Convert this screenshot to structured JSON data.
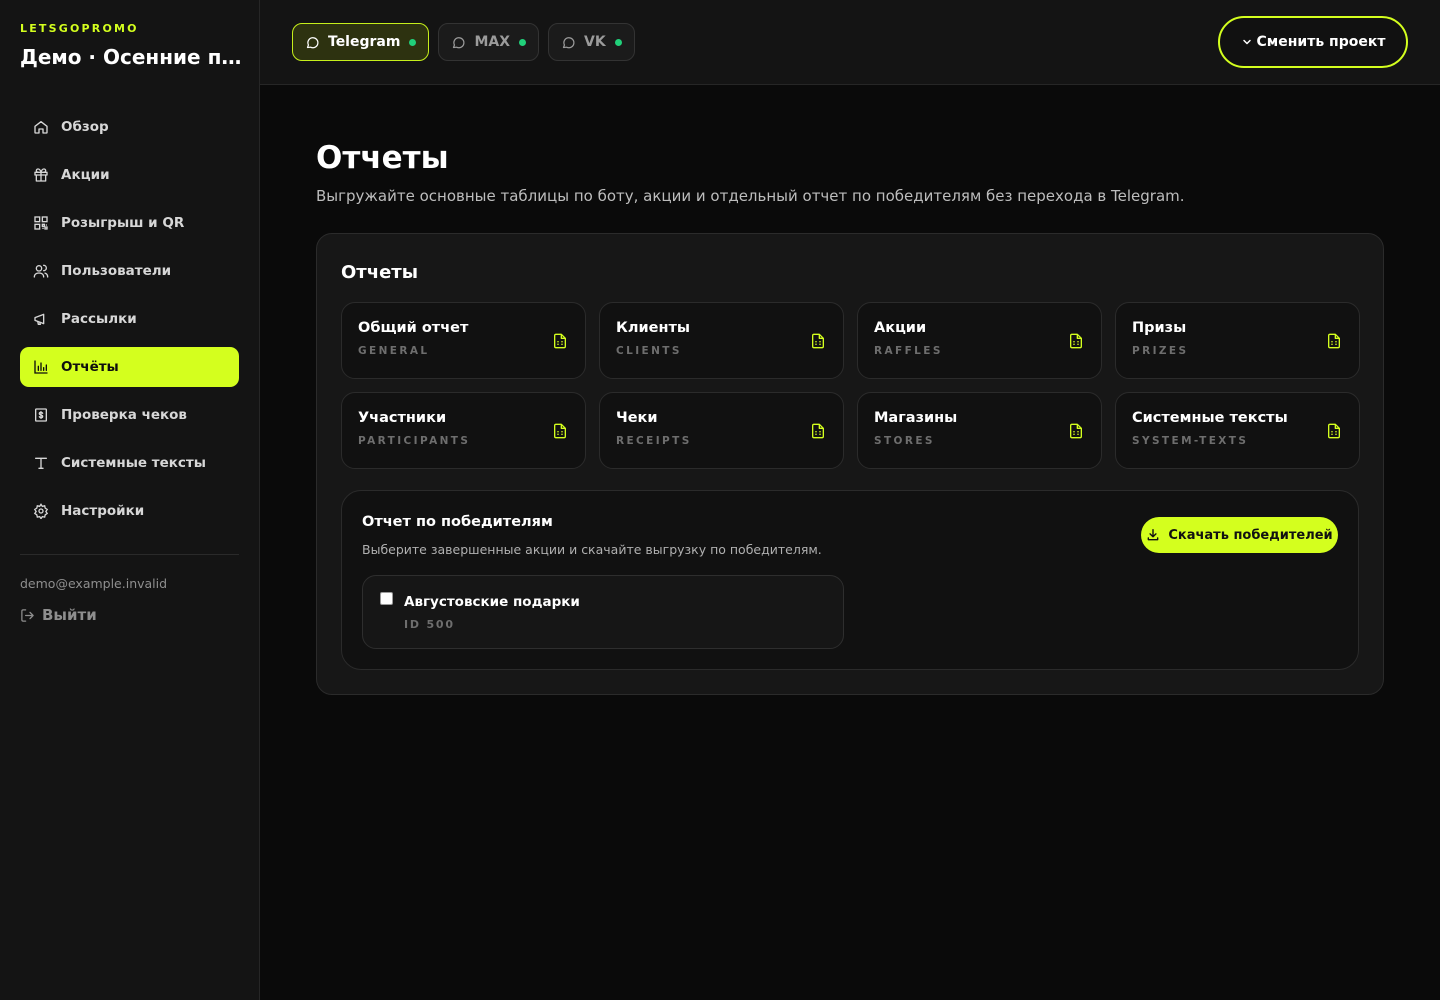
{
  "sidebar": {
    "brand_kicker": "LETSGOPROMO",
    "project_title": "Демо · Осенние п...",
    "nav": [
      {
        "label": "Обзор",
        "icon": "home-icon"
      },
      {
        "label": "Акции",
        "icon": "gift-icon"
      },
      {
        "label": "Розыгрыш и QR",
        "icon": "qr-icon"
      },
      {
        "label": "Пользователи",
        "icon": "users-icon"
      },
      {
        "label": "Рассылки",
        "icon": "megaphone-icon"
      },
      {
        "label": "Отчёты",
        "icon": "bar-chart-icon",
        "active": true
      },
      {
        "label": "Проверка чеков",
        "icon": "receipt-icon"
      },
      {
        "label": "Системные тексты",
        "icon": "type-icon"
      },
      {
        "label": "Настройки",
        "icon": "gear-icon"
      }
    ],
    "user_email": "demo@example.invalid",
    "logout_label": "Выйти"
  },
  "topbar": {
    "channels": [
      {
        "label": "Telegram",
        "active": true,
        "status": "online"
      },
      {
        "label": "MAX",
        "active": false,
        "status": "online"
      },
      {
        "label": "VK",
        "active": false,
        "status": "online"
      }
    ],
    "switch_project_label": "Сменить проект"
  },
  "main": {
    "title": "Отчеты",
    "subtitle": "Выгружайте основные таблицы по боту, акции и отдельный отчет по победителям без перехода в Telegram.",
    "panel_title": "Отчеты",
    "reports": [
      {
        "name": "Общий отчет",
        "code": "GENERAL"
      },
      {
        "name": "Клиенты",
        "code": "CLIENTS"
      },
      {
        "name": "Акции",
        "code": "RAFFLES"
      },
      {
        "name": "Призы",
        "code": "PRIZES"
      },
      {
        "name": "Участники",
        "code": "PARTICIPANTS"
      },
      {
        "name": "Чеки",
        "code": "RECEIPTS"
      },
      {
        "name": "Магазины",
        "code": "STORES"
      },
      {
        "name": "Системные тексты",
        "code": "SYSTEM-TEXTS"
      }
    ],
    "winners": {
      "title": "Отчет по победителям",
      "description": "Выберите завершенные акции и скачайте выгрузку по победителям.",
      "download_label": "Скачать победителей",
      "raffles": [
        {
          "name": "Августовские подарки",
          "id_label": "ID 500",
          "checked": false
        }
      ]
    }
  },
  "colors": {
    "accent": "#d4ff1e",
    "background": "#0a0a0a",
    "sidebar": "#141414",
    "status_online": "#21d07a"
  }
}
